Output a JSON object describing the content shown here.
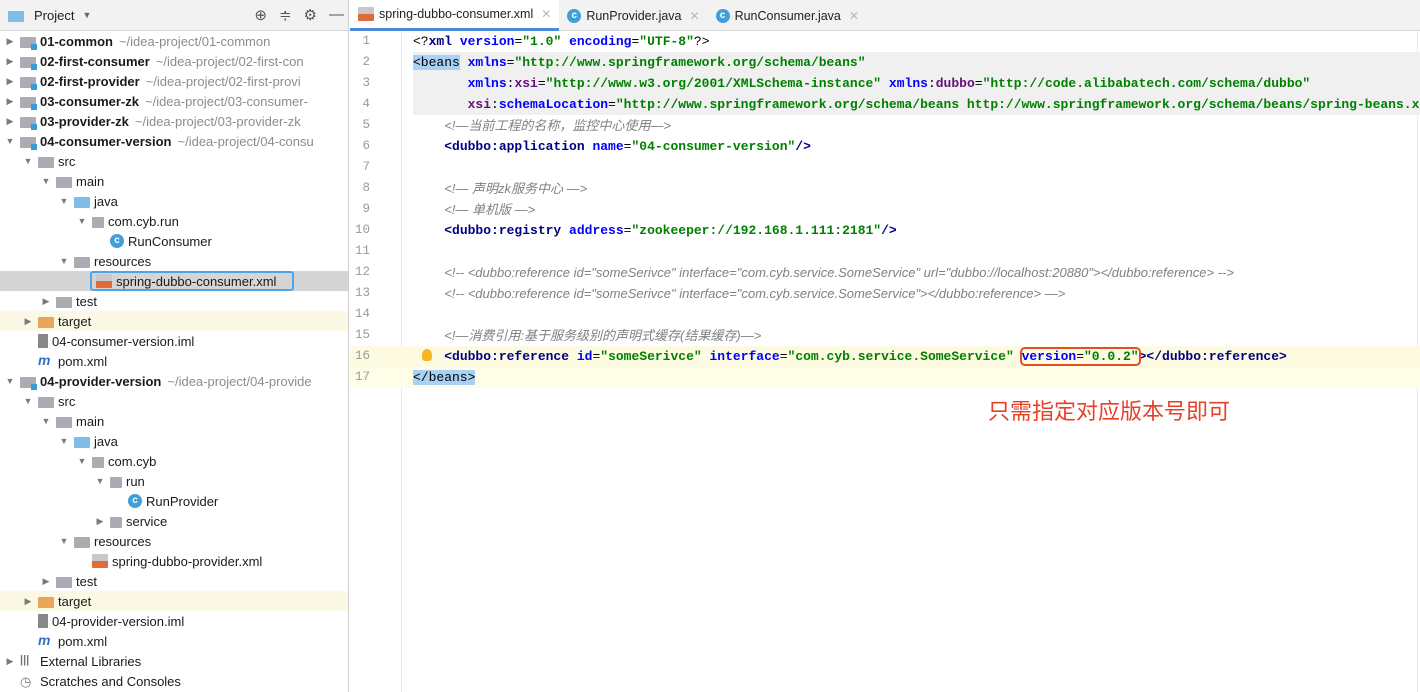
{
  "sidebar": {
    "title": "Project",
    "tree": [
      {
        "level": 0,
        "arrow": "▶",
        "icon": "module",
        "label": "01-common",
        "bold": true,
        "path": "~/idea-project/01-common"
      },
      {
        "level": 0,
        "arrow": "▶",
        "icon": "module",
        "label": "02-first-consumer",
        "bold": true,
        "path": "~/idea-project/02-first-con"
      },
      {
        "level": 0,
        "arrow": "▶",
        "icon": "module",
        "label": "02-first-provider",
        "bold": true,
        "path": "~/idea-project/02-first-provi"
      },
      {
        "level": 0,
        "arrow": "▶",
        "icon": "module",
        "label": "03-consumer-zk",
        "bold": true,
        "path": "~/idea-project/03-consumer-"
      },
      {
        "level": 0,
        "arrow": "▶",
        "icon": "module",
        "label": "03-provider-zk",
        "bold": true,
        "path": "~/idea-project/03-provider-zk"
      },
      {
        "level": 0,
        "arrow": "▼",
        "icon": "module",
        "label": "04-consumer-version",
        "bold": true,
        "path": "~/idea-project/04-consu"
      },
      {
        "level": 1,
        "arrow": "▼",
        "icon": "folder",
        "label": "src"
      },
      {
        "level": 2,
        "arrow": "▼",
        "icon": "folder",
        "label": "main"
      },
      {
        "level": 3,
        "arrow": "▼",
        "icon": "folder-blue",
        "label": "java"
      },
      {
        "level": 4,
        "arrow": "▼",
        "icon": "package",
        "label": "com.cyb.run"
      },
      {
        "level": 5,
        "arrow": "",
        "icon": "class",
        "label": "RunConsumer"
      },
      {
        "level": 3,
        "arrow": "▼",
        "icon": "resources",
        "label": "resources"
      },
      {
        "level": 4,
        "arrow": "",
        "icon": "xml",
        "label": "spring-dubbo-consumer.xml",
        "selected": true
      },
      {
        "level": 2,
        "arrow": "▶",
        "icon": "folder",
        "label": "test"
      },
      {
        "level": 1,
        "arrow": "▶",
        "icon": "folder-orange",
        "label": "target",
        "highlight": true
      },
      {
        "level": 1,
        "arrow": "",
        "icon": "iml",
        "label": "04-consumer-version.iml"
      },
      {
        "level": 1,
        "arrow": "",
        "icon": "maven",
        "label": "pom.xml"
      },
      {
        "level": 0,
        "arrow": "▼",
        "icon": "module",
        "label": "04-provider-version",
        "bold": true,
        "path": "~/idea-project/04-provide"
      },
      {
        "level": 1,
        "arrow": "▼",
        "icon": "folder",
        "label": "src"
      },
      {
        "level": 2,
        "arrow": "▼",
        "icon": "folder",
        "label": "main"
      },
      {
        "level": 3,
        "arrow": "▼",
        "icon": "folder-blue",
        "label": "java"
      },
      {
        "level": 4,
        "arrow": "▼",
        "icon": "package",
        "label": "com.cyb"
      },
      {
        "level": 5,
        "arrow": "▼",
        "icon": "package",
        "label": "run"
      },
      {
        "level": 6,
        "arrow": "",
        "icon": "class",
        "label": "RunProvider"
      },
      {
        "level": 5,
        "arrow": "▶",
        "icon": "package",
        "label": "service"
      },
      {
        "level": 3,
        "arrow": "▼",
        "icon": "resources",
        "label": "resources"
      },
      {
        "level": 4,
        "arrow": "",
        "icon": "xml",
        "label": "spring-dubbo-provider.xml"
      },
      {
        "level": 2,
        "arrow": "▶",
        "icon": "folder",
        "label": "test"
      },
      {
        "level": 1,
        "arrow": "▶",
        "icon": "folder-orange",
        "label": "target",
        "highlight": true
      },
      {
        "level": 1,
        "arrow": "",
        "icon": "iml",
        "label": "04-provider-version.iml"
      },
      {
        "level": 1,
        "arrow": "",
        "icon": "maven",
        "label": "pom.xml"
      },
      {
        "level": 0,
        "arrow": "▶",
        "icon": "libraries",
        "label": "External Libraries"
      },
      {
        "level": 0,
        "arrow": "",
        "icon": "scratches",
        "label": "Scratches and Consoles"
      }
    ]
  },
  "tabs": [
    {
      "label": "spring-dubbo-consumer.xml",
      "icon": "xml",
      "active": true
    },
    {
      "label": "RunProvider.java",
      "icon": "class"
    },
    {
      "label": "RunConsumer.java",
      "icon": "class"
    }
  ],
  "code": [
    {
      "n": "1",
      "tokens": [
        [
          "p",
          "<?"
        ],
        [
          "tag",
          "xml "
        ],
        [
          "attr",
          "version"
        ],
        [
          "p",
          "="
        ],
        [
          "val",
          "\"1.0\" "
        ],
        [
          "attr",
          "encoding"
        ],
        [
          "p",
          "="
        ],
        [
          "val",
          "\"UTF-8\""
        ],
        [
          "p",
          "?>"
        ]
      ]
    },
    {
      "n": "2",
      "bg": "gray",
      "tokens": [
        [
          "hl",
          "<beans"
        ],
        [
          "p",
          " "
        ],
        [
          "attr",
          "xmlns"
        ],
        [
          "p",
          "="
        ],
        [
          "val",
          "\"http://www.springframework.org/schema/beans\""
        ]
      ]
    },
    {
      "n": "3",
      "bg": "gray",
      "tokens": [
        [
          "p",
          "       "
        ],
        [
          "attr",
          "xmlns"
        ],
        [
          "p",
          ":"
        ],
        [
          "ns",
          "xsi"
        ],
        [
          "p",
          "="
        ],
        [
          "val",
          "\"http://www.w3.org/2001/XMLSchema-instance\" "
        ],
        [
          "attr",
          "xmlns"
        ],
        [
          "p",
          ":"
        ],
        [
          "ns",
          "dubbo"
        ],
        [
          "p",
          "="
        ],
        [
          "val",
          "\"http://code.alibabatech.com/schema/dubbo\""
        ]
      ]
    },
    {
      "n": "4",
      "bg": "gray",
      "tokens": [
        [
          "p",
          "       "
        ],
        [
          "ns",
          "xsi"
        ],
        [
          "p",
          ":"
        ],
        [
          "attr",
          "schemaLocation"
        ],
        [
          "p",
          "="
        ],
        [
          "val",
          "\"http://www.springframework.org/schema/beans http://www.springframework.org/schema/beans/spring-beans.xsd"
        ]
      ]
    },
    {
      "n": "5",
      "tokens": [
        [
          "p",
          "    "
        ],
        [
          "c",
          "<!—当前工程的名称，监控中心使用—>"
        ]
      ]
    },
    {
      "n": "6",
      "tokens": [
        [
          "p",
          "    "
        ],
        [
          "tag",
          "<dubbo:application "
        ],
        [
          "attr",
          "name"
        ],
        [
          "p",
          "="
        ],
        [
          "val",
          "\"04-consumer-version\""
        ],
        [
          "tag",
          "/>"
        ]
      ]
    },
    {
      "n": "7",
      "tokens": []
    },
    {
      "n": "8",
      "tokens": [
        [
          "p",
          "    "
        ],
        [
          "c",
          "<!— 声明zk服务中心 —>"
        ]
      ]
    },
    {
      "n": "9",
      "tokens": [
        [
          "p",
          "    "
        ],
        [
          "c",
          "<!— 单机版 —>"
        ]
      ]
    },
    {
      "n": "10",
      "tokens": [
        [
          "p",
          "    "
        ],
        [
          "tag",
          "<dubbo:registry "
        ],
        [
          "attr",
          "address"
        ],
        [
          "p",
          "="
        ],
        [
          "val",
          "\"zookeeper://192.168.1.111:2181\""
        ],
        [
          "tag",
          "/>"
        ]
      ]
    },
    {
      "n": "11",
      "tokens": []
    },
    {
      "n": "12",
      "tokens": [
        [
          "p",
          "    "
        ],
        [
          "c",
          "<!-- <dubbo:reference id=\"someSerivce\" interface=\"com.cyb.service.SomeService\" url=\"dubbo://localhost:20880\"></dubbo:reference> -->"
        ]
      ]
    },
    {
      "n": "13",
      "tokens": [
        [
          "p",
          "    "
        ],
        [
          "c",
          "<!-- <dubbo:reference id=\"someSerivce\" interface=\"com.cyb.service.SomeService\"></dubbo:reference> —>"
        ]
      ]
    },
    {
      "n": "14",
      "tokens": []
    },
    {
      "n": "15",
      "tokens": [
        [
          "p",
          "    "
        ],
        [
          "c",
          "<!—消费引用:基于服务级别的声明式缓存(结果缓存)—>"
        ]
      ]
    },
    {
      "n": "16",
      "bg": "yellow",
      "tokens": [
        [
          "p",
          "    "
        ],
        [
          "tag",
          "<dubbo:reference "
        ],
        [
          "attr",
          "id"
        ],
        [
          "p",
          "="
        ],
        [
          "val",
          "\"someSerivce\" "
        ],
        [
          "attr",
          "interface"
        ],
        [
          "p",
          "="
        ],
        [
          "val",
          "\"com.cyb.service.SomeService\""
        ],
        [
          "p",
          " "
        ],
        [
          "attr",
          "version",
          "boxed"
        ],
        [
          "p",
          "=",
          "boxed"
        ],
        [
          "val",
          "\"0.0.2\"",
          "boxed"
        ],
        [
          "tag",
          "></dubbo:reference>"
        ]
      ]
    },
    {
      "n": "17",
      "bg": "caret",
      "tokens": [
        [
          "hl",
          "</beans>"
        ]
      ]
    }
  ],
  "annotation": "只需指定对应版本号即可",
  "colors": {
    "annotation": "#e5402a",
    "selection_outline": "#4ca5e6",
    "accent": "#4a8ad8"
  }
}
